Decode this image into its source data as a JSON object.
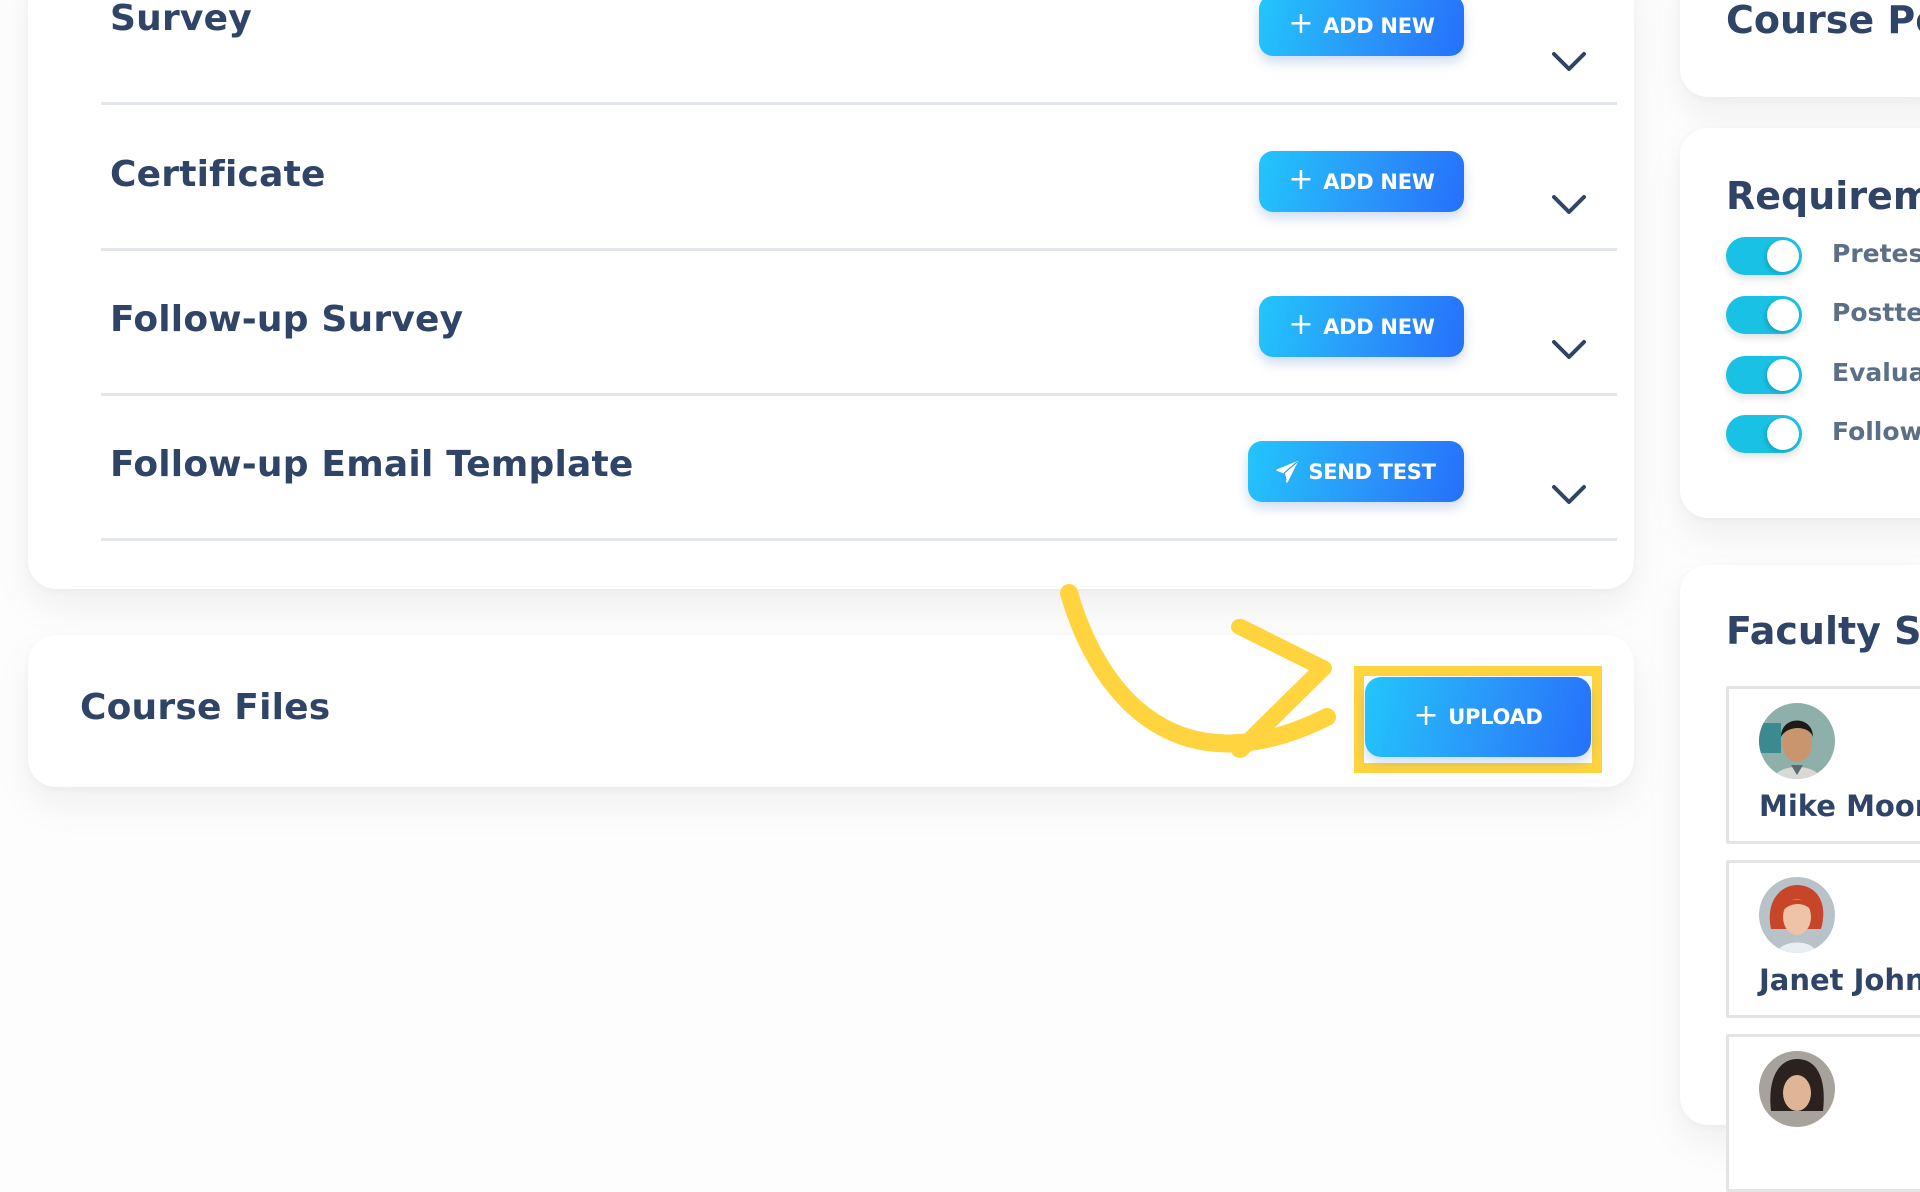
{
  "main": {
    "sections": [
      {
        "title": "Survey",
        "button": "ADD NEW",
        "button_icon": "plus-icon"
      },
      {
        "title": "Certificate",
        "button": "ADD NEW",
        "button_icon": "plus-icon"
      },
      {
        "title": "Follow-up Survey",
        "button": "ADD NEW",
        "button_icon": "plus-icon"
      },
      {
        "title": "Follow-up Email Template",
        "button": "SEND TEST",
        "button_icon": "paper-plane-icon"
      }
    ]
  },
  "course_files": {
    "title": "Course Files",
    "upload_label": "UPLOAD",
    "plus": "+"
  },
  "sidebar": {
    "course_points_title": "Course Po",
    "requirements": {
      "title": "Requireme",
      "items": [
        {
          "label": "Pretest",
          "enabled": true
        },
        {
          "label": "Posttest",
          "enabled": true
        },
        {
          "label": "Evaluation",
          "enabled": true
        },
        {
          "label": "Follow",
          "enabled": true
        }
      ]
    },
    "faculty": {
      "title": "Faculty Se",
      "people": [
        {
          "name": "Mike Moore"
        },
        {
          "name": "Janet Johnson"
        },
        {
          "name": ""
        }
      ]
    }
  },
  "common": {
    "plus": "+"
  },
  "colors": {
    "accent_start": "#22c6fb",
    "accent_end": "#2670fb",
    "toggle_on": "#19c1e5",
    "heading": "#2f4466",
    "annotation": "#ffd43f"
  }
}
